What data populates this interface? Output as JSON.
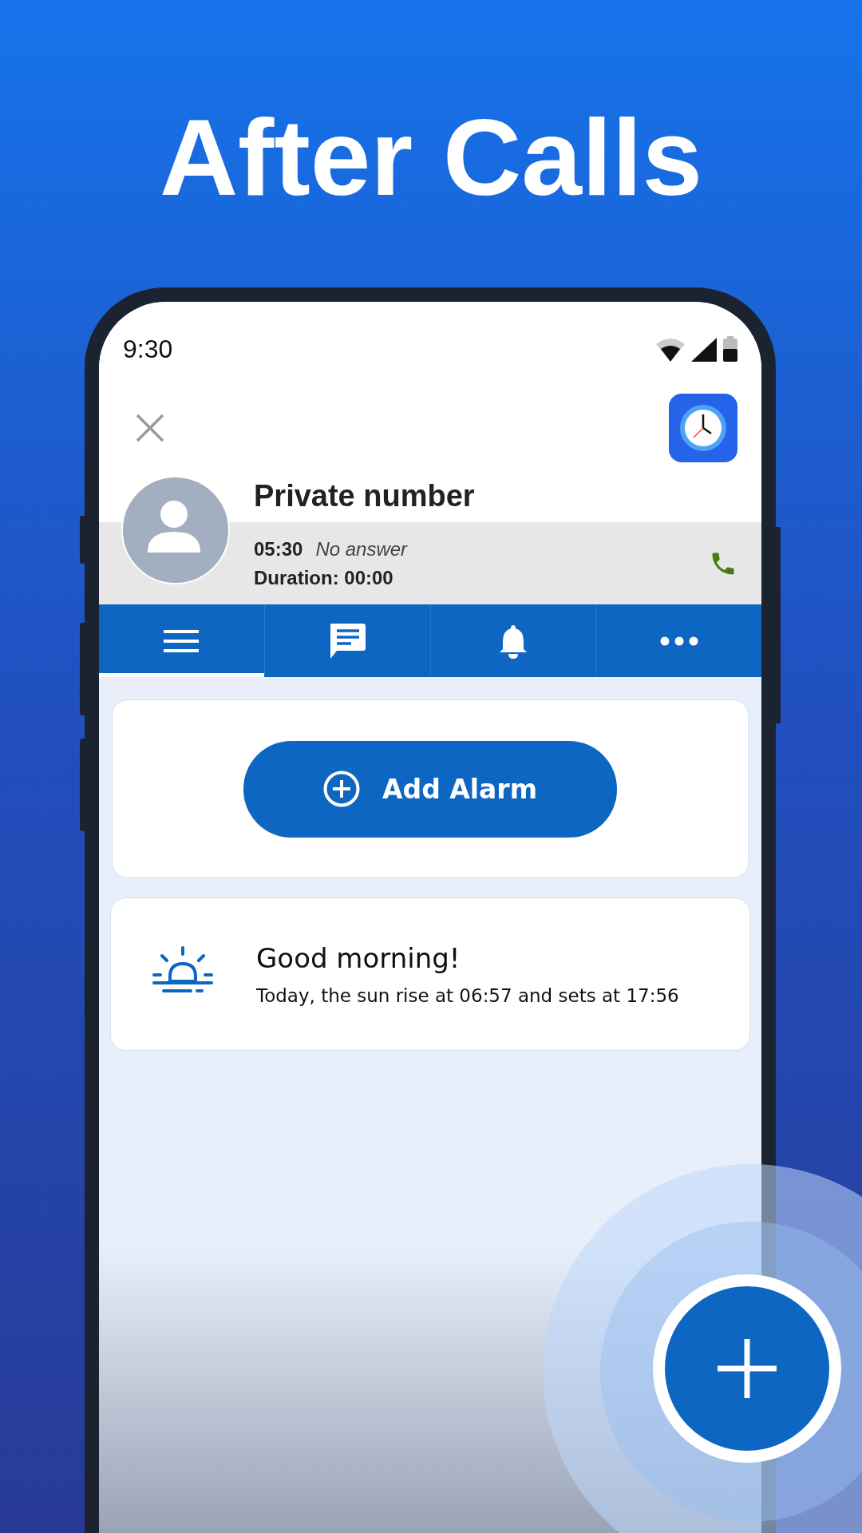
{
  "headline": "After Calls",
  "status_bar": {
    "time": "9:30"
  },
  "call": {
    "name": "Private number",
    "time": "05:30",
    "status": "No answer",
    "duration": "Duration: 00:00"
  },
  "tabs": [
    {
      "kind": "menu",
      "selected": true
    },
    {
      "kind": "message",
      "selected": false
    },
    {
      "kind": "bell",
      "selected": false
    },
    {
      "kind": "more",
      "selected": false
    }
  ],
  "add_button": {
    "label": "Add Alarm"
  },
  "greeting": {
    "title": "Good morning!",
    "text": "Today, the sun rise at 06:57 and sets at 17:56"
  }
}
